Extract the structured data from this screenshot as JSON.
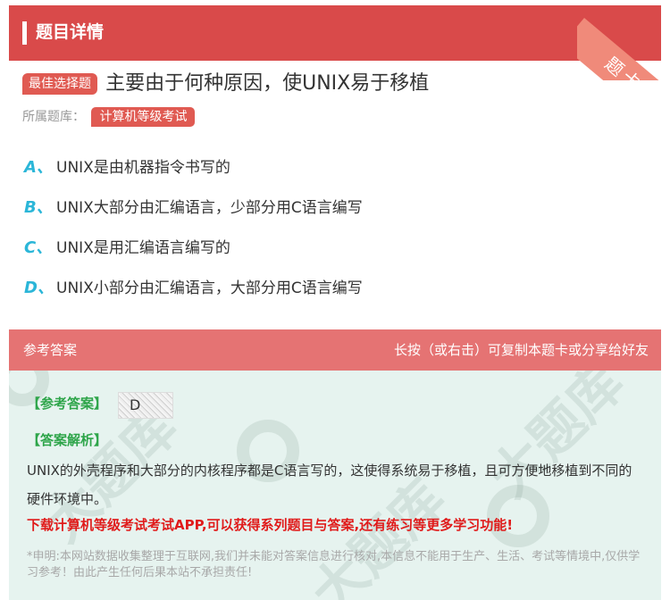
{
  "header": {
    "title": "题目详情",
    "ribbon": "题卡"
  },
  "question": {
    "badge": "最佳选择题",
    "text": "主要由于何种原因，使UNIX易于移植",
    "library_label": "所属题库：",
    "library_tag": "计算机等级考试"
  },
  "options": [
    {
      "letter": "A、",
      "text": "UNIX是由机器指令书写的"
    },
    {
      "letter": "B、",
      "text": "UNIX大部分由汇编语言，少部分用C语言编写"
    },
    {
      "letter": "C、",
      "text": "UNIX是用汇编语言编写的"
    },
    {
      "letter": "D、",
      "text": "UNIX小部分由汇编语言，大部分用C语言编写"
    }
  ],
  "answer": {
    "header_left": "参考答案",
    "header_right": "长按（或右击）可复制本题卡或分享给好友",
    "answer_label": "【参考答案】",
    "answer_value": "D",
    "analysis_label": "【答案解析】",
    "analysis_text": "UNIX的外壳程序和大部分的内核程序都是C语言写的，这使得系统易于移植，且可方便地移植到不同的硬件环境中。",
    "promo": "下载计算机等级考试考试APP,可以获得系列题目与答案,还有练习等更多学习功能!",
    "disclaimer": "*申明:本网站数据收集整理于互联网,我们并未能对答案信息进行核对,本信息不能用于生产、生活、考试等情境中,仅供学习参考！由此产生任何后果本站不承担责任!",
    "watermark": "大题库"
  },
  "colors": {
    "header": "#d94a4a",
    "accent": "#e05a52",
    "option_letter": "#2bb6d8",
    "answer_label": "#2ea54a",
    "promo": "#e01b1b"
  }
}
